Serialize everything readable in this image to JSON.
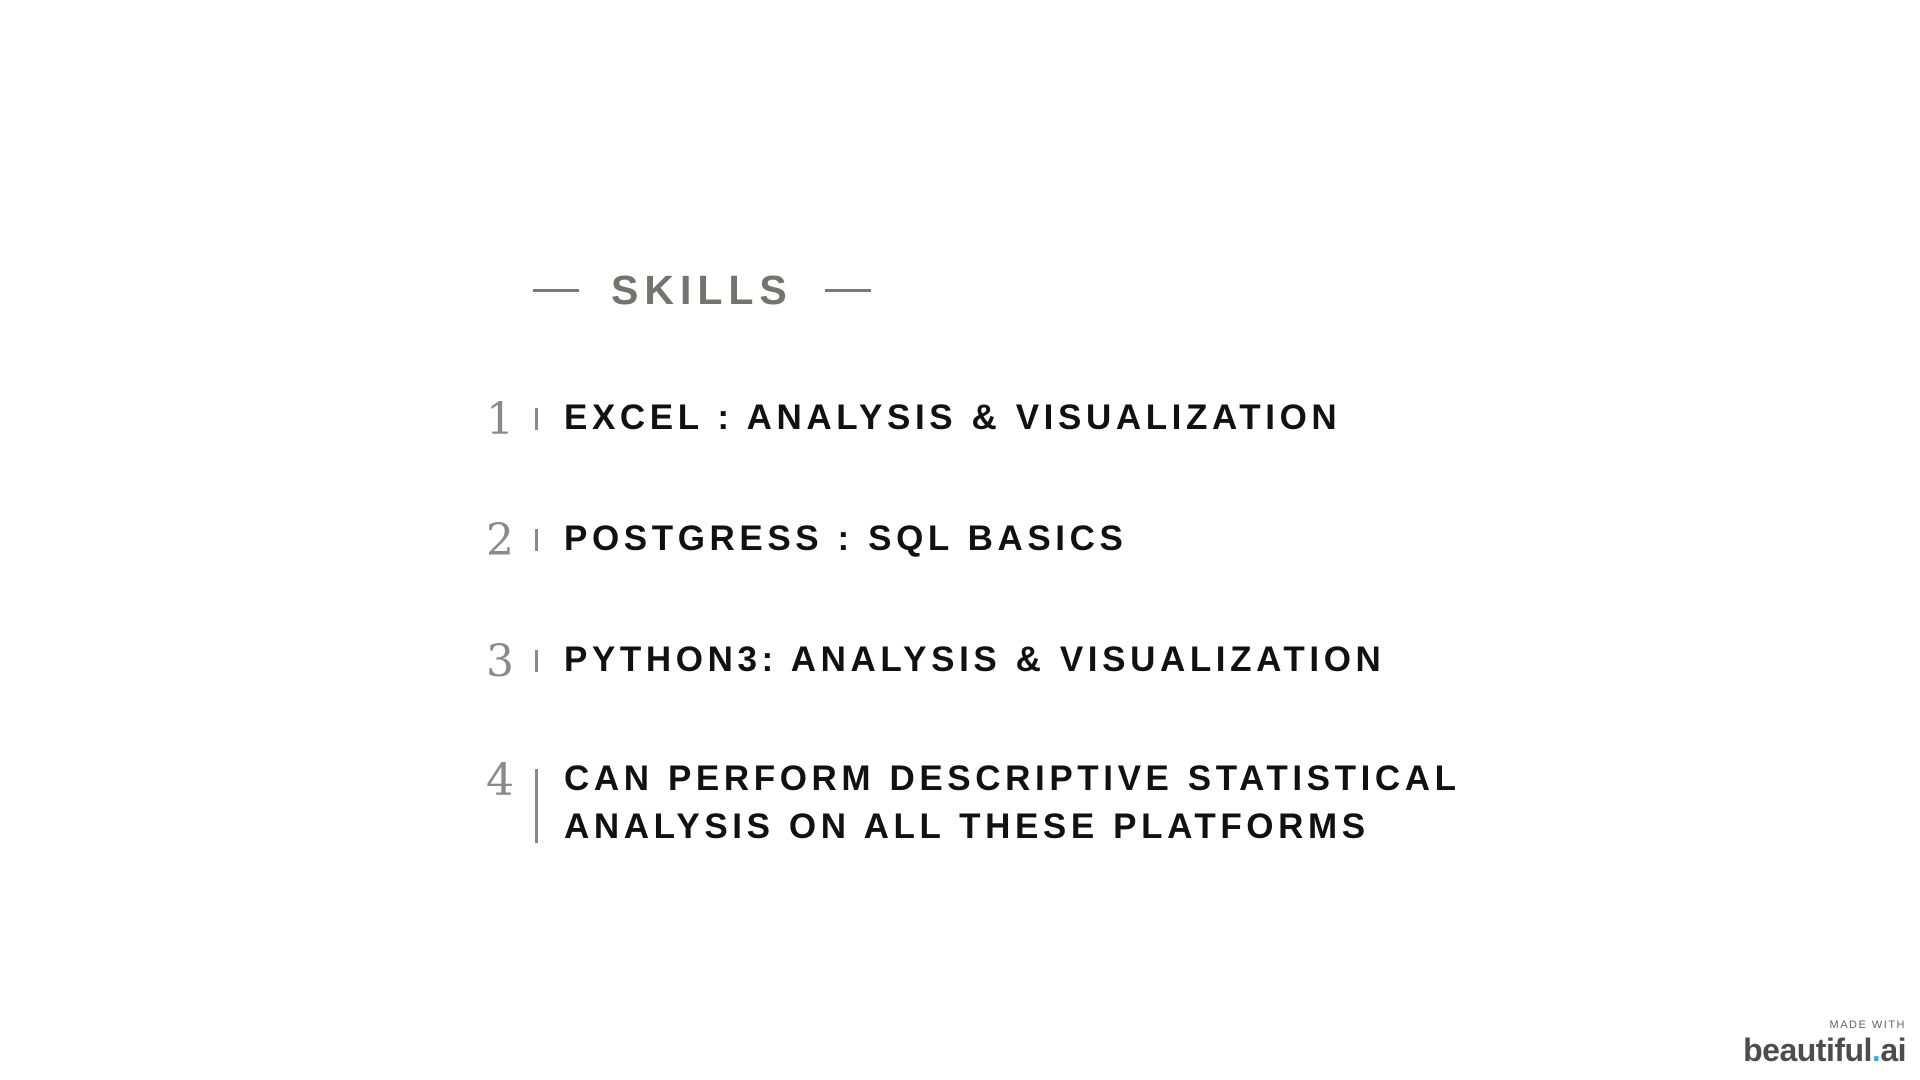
{
  "heading": "SKILLS",
  "skills": [
    {
      "number": "1",
      "line1": "EXCEL : ANALYSIS & VISUALIZATION",
      "line2": ""
    },
    {
      "number": "2",
      "line1": "POSTGRESS : SQL BASICS",
      "line2": ""
    },
    {
      "number": "3",
      "line1": "PYTHON3: ANALYSIS & VISUALIZATION",
      "line2": ""
    },
    {
      "number": "4",
      "line1": "CAN PERFORM DESCRIPTIVE STATISTICAL",
      "line2": "ANALYSIS ON ALL THESE PLATFORMS"
    }
  ],
  "badge": {
    "small_text": "MADE WITH",
    "logo_main": "beautiful",
    "logo_dot": ".",
    "logo_suffix": "ai"
  },
  "colors": {
    "heading": "#74746c",
    "skill_text": "#111111",
    "number": "#8a8a8a",
    "accent_dot": "#39a9e0"
  }
}
